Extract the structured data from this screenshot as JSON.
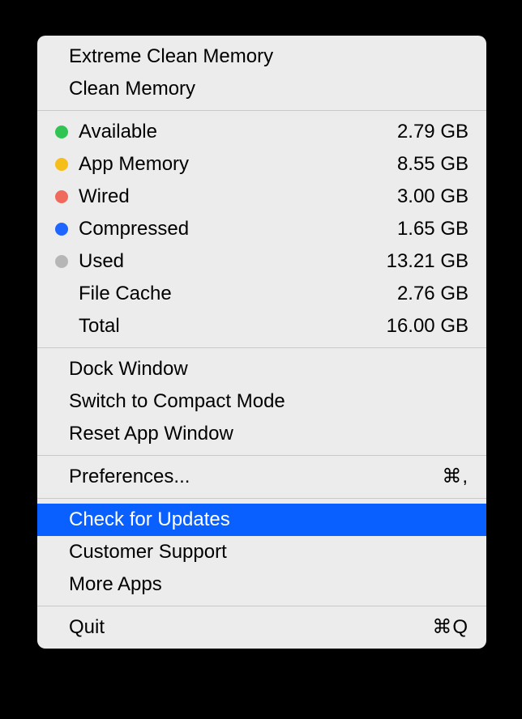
{
  "top_actions": {
    "extreme_clean": "Extreme Clean Memory",
    "clean": "Clean Memory"
  },
  "memory_stats": [
    {
      "label": "Available",
      "value": "2.79 GB",
      "color": "green"
    },
    {
      "label": "App Memory",
      "value": "8.55 GB",
      "color": "yellow"
    },
    {
      "label": "Wired",
      "value": "3.00 GB",
      "color": "red"
    },
    {
      "label": "Compressed",
      "value": "1.65 GB",
      "color": "blue"
    },
    {
      "label": "Used",
      "value": "13.21 GB",
      "color": "gray"
    },
    {
      "label": "File Cache",
      "value": "2.76 GB",
      "color": null
    },
    {
      "label": "Total",
      "value": "16.00 GB",
      "color": null
    }
  ],
  "window_actions": {
    "dock": "Dock Window",
    "compact": "Switch to Compact Mode",
    "reset": "Reset App Window"
  },
  "preferences": {
    "label": "Preferences...",
    "shortcut": "⌘,"
  },
  "support_actions": {
    "updates": "Check for Updates",
    "support": "Customer Support",
    "more_apps": "More Apps"
  },
  "quit": {
    "label": "Quit",
    "shortcut": "⌘Q"
  }
}
